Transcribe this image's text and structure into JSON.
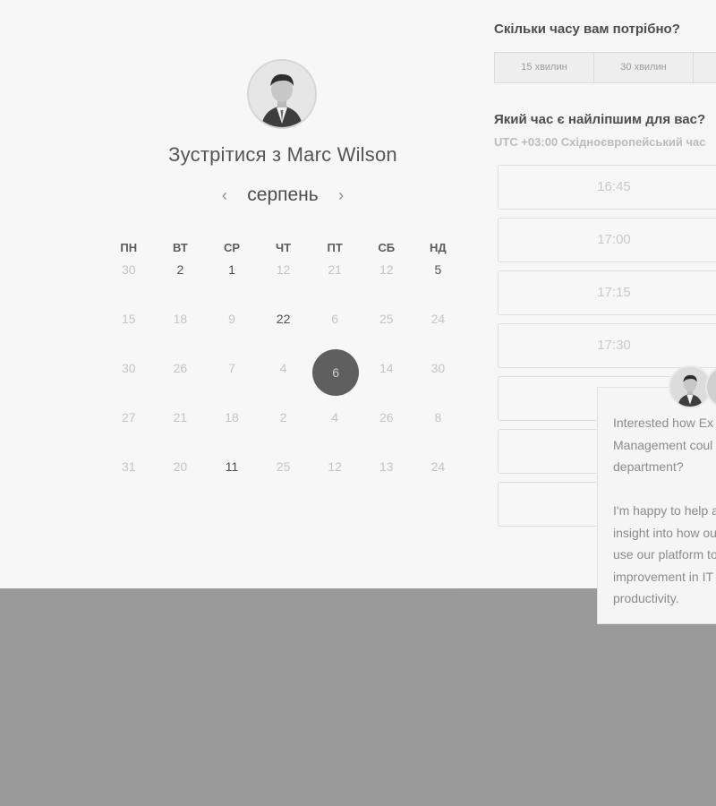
{
  "meeting": {
    "title": "Зустрітися з Marc Wilson",
    "month": "серпень",
    "prev_icon": "chevron-left-icon",
    "next_icon": "chevron-right-icon"
  },
  "calendar": {
    "weekdays": [
      "ПН",
      "ВТ",
      "СР",
      "ЧТ",
      "ПТ",
      "СБ",
      "НД"
    ],
    "weeks": [
      [
        {
          "d": "30",
          "dark": false
        },
        {
          "d": "2",
          "dark": true
        },
        {
          "d": "1",
          "dark": true
        },
        {
          "d": "12",
          "dark": false
        },
        {
          "d": "21",
          "dark": false
        },
        {
          "d": "12",
          "dark": false
        },
        {
          "d": "5",
          "dark": true
        }
      ],
      [
        {
          "d": "15",
          "dark": false
        },
        {
          "d": "18",
          "dark": false
        },
        {
          "d": "9",
          "dark": false
        },
        {
          "d": "22",
          "dark": true
        },
        {
          "d": "6",
          "dark": false
        },
        {
          "d": "25",
          "dark": false
        },
        {
          "d": "24",
          "dark": false
        }
      ],
      [
        {
          "d": "30",
          "dark": false
        },
        {
          "d": "26",
          "dark": false
        },
        {
          "d": "7",
          "dark": false
        },
        {
          "d": "4",
          "dark": false
        },
        {
          "d": "6",
          "dark": false,
          "selected": true
        },
        {
          "d": "14",
          "dark": false
        },
        {
          "d": "30",
          "dark": false
        }
      ],
      [
        {
          "d": "27",
          "dark": false
        },
        {
          "d": "21",
          "dark": false
        },
        {
          "d": "18",
          "dark": false
        },
        {
          "d": "2",
          "dark": false
        },
        {
          "d": "4",
          "dark": false
        },
        {
          "d": "26",
          "dark": false
        },
        {
          "d": "8",
          "dark": false
        }
      ],
      [
        {
          "d": "31",
          "dark": false
        },
        {
          "d": "20",
          "dark": false
        },
        {
          "d": "11",
          "dark": true
        },
        {
          "d": "25",
          "dark": false
        },
        {
          "d": "12",
          "dark": false
        },
        {
          "d": "13",
          "dark": false
        },
        {
          "d": "24",
          "dark": false
        }
      ]
    ]
  },
  "duration": {
    "question": "Скільки часу вам потрібно?",
    "options": [
      "15 хвилин",
      "30 хвилин",
      ""
    ]
  },
  "time": {
    "question": "Який час є найліпшим для вас?",
    "timezone": "UTC +03:00 Східноєвропейський час",
    "slots": [
      "16:45",
      "17:00",
      "17:15",
      "17:30",
      "",
      "",
      ""
    ]
  },
  "chat": {
    "lines": [
      "Interested how Ex",
      "Management coul",
      "department?",
      "",
      "I'm happy to help a",
      "insight into how ou",
      "use our platform to",
      "improvement in IT",
      "productivity."
    ]
  }
}
